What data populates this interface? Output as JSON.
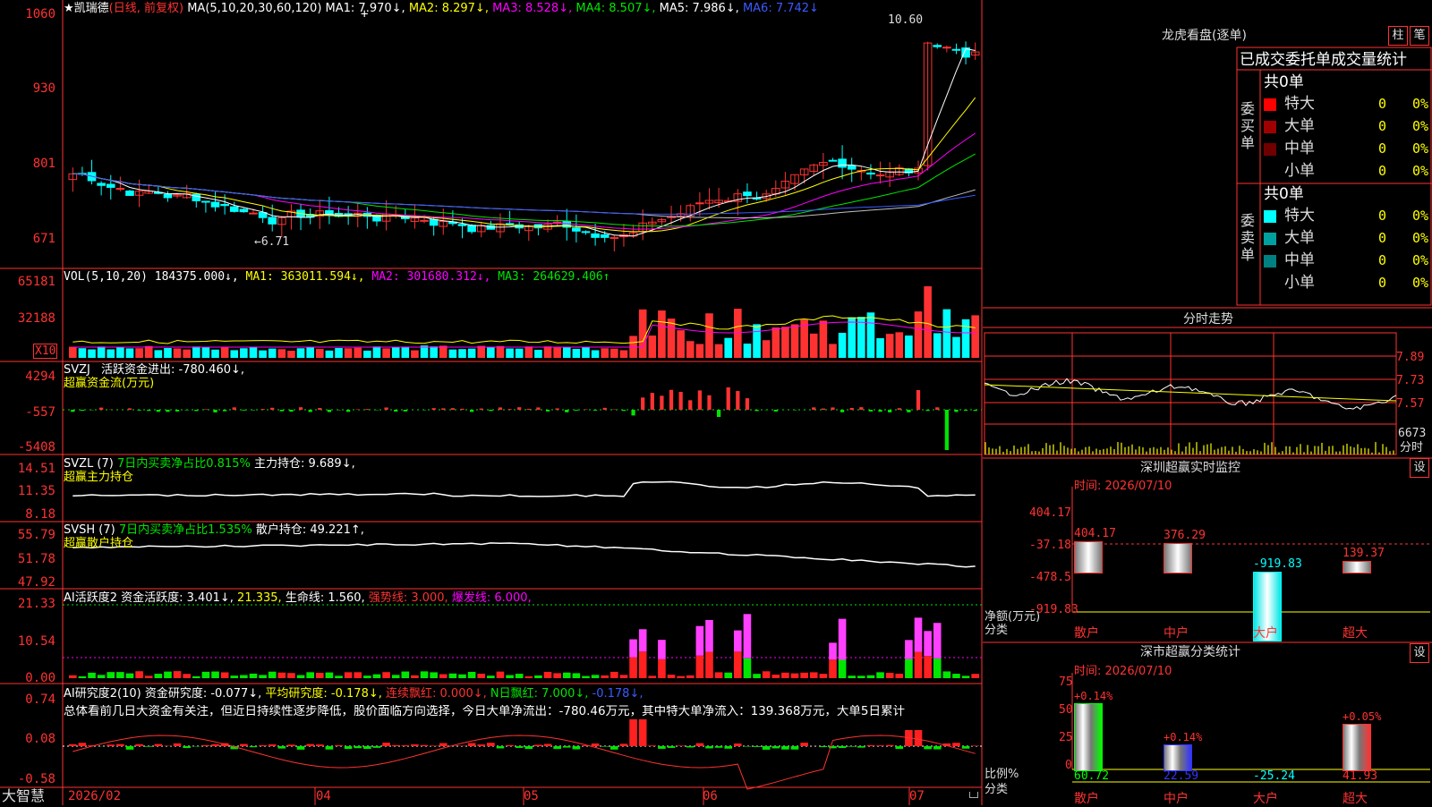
{
  "left_axis": {
    "kline": [
      "1060",
      "930",
      "801",
      "671"
    ],
    "vol": [
      "65181",
      "32188",
      "X10"
    ],
    "svzj": [
      "4294",
      "-557",
      "-5408"
    ],
    "svzl": [
      "14.51",
      "11.35",
      "8.18"
    ],
    "svsh": [
      "55.79",
      "51.78",
      "47.92"
    ],
    "ai2": [
      "21.33",
      "10.54",
      "0.00"
    ],
    "ai3": [
      "0.74",
      "0.08",
      "-0.58"
    ]
  },
  "kline": {
    "stock": "★凯瑞德",
    "mode": "(日线, 前复权)",
    "ma_label": "MA(5,10,20,30,60,120)",
    "ma1": "MA1: 7.970↓,",
    "ma2": "MA2: 8.297↓,",
    "ma3": "MA3: 8.528↓,",
    "ma4": "MA4: 8.507↓,",
    "ma5": "MA5: 7.986↓,",
    "ma6": "MA6: 7.742↓",
    "high_mark": "10.60",
    "low_mark": "←6.71",
    "colors": {
      "up": "#ff3232",
      "down": "#00ffff",
      "ma1": "#ffffff",
      "ma2": "#ffff00",
      "ma3": "#ff00ff",
      "ma4": "#00e600",
      "ma5": "#c0c0c0",
      "ma6": "#3a5bff"
    }
  },
  "vol": {
    "label": "VOL(5,10,20)",
    "value": "184375.000↓,",
    "ma1": "MA1: 363011.594↓,",
    "ma2": "MA2: 301680.312↓,",
    "ma3": "MA3: 264629.406↑"
  },
  "svzj": {
    "label": "SVZJ",
    "text": "活跃资金进出: -780.460↓,",
    "sub": "超赢资金流(万元)"
  },
  "svzl": {
    "label": "SVZL (7)",
    "text": "7日内买卖净占比0.815%",
    "text2": "主力持仓: 9.689↓,",
    "sub": "超赢主力持仓"
  },
  "svsh": {
    "label": "SVSH (7)",
    "text": "7日内买卖净占比1.535%",
    "text2": "散户持仓: 49.221↑,",
    "sub": "超赢散户持仓"
  },
  "ai2": {
    "label": "AI活跃度2",
    "t1": "资金活跃度: 3.401↓,",
    "t2": "21.335,",
    "t3": "生命线: 1.560,",
    "t4": "强势线: 3.000,",
    "t5": "爆发线: 6.000,"
  },
  "ai3": {
    "label": "AI研究度2(10)",
    "t1": "资金研究度: -0.077↓,",
    "t2": "平均研究度: -0.178↓,",
    "t3": "连续飘红: 0.000↓,",
    "t4": "N日飘红: 7.000↓,",
    "t5": "-0.178↓,",
    "summary": "总体看前几日大资金有关注，但近日持续性逐步降低，股价面临方向选择，今日大单净流出：-780.46万元，其中特大单净流入：139.368万元，大单5日累计"
  },
  "footer": {
    "brand": "大智慧",
    "dates": [
      "2026/02",
      "04",
      "05",
      "06",
      "07"
    ]
  },
  "dragon": {
    "title": "龙虎看盘(逐单)",
    "btn1": "柱",
    "btn2": "笔",
    "header": "已成交委托单成交量统计",
    "buy_label": "委买单",
    "sell_label": "委卖单",
    "buy_total": "共0单",
    "sell_total": "共0单",
    "buy_rows": [
      {
        "name": "特大",
        "count": "0",
        "pct": "0%",
        "color": "#ff0000"
      },
      {
        "name": "大单",
        "count": "0",
        "pct": "0%",
        "color": "#a00000"
      },
      {
        "name": "中单",
        "count": "0",
        "pct": "0%",
        "color": "#700000"
      },
      {
        "name": "小单",
        "count": "0",
        "pct": "0%",
        "color": ""
      }
    ],
    "sell_rows": [
      {
        "name": "特大",
        "count": "0",
        "pct": "0%",
        "color": "#00ffff"
      },
      {
        "name": "大单",
        "count": "0",
        "pct": "0%",
        "color": "#00a0a0"
      },
      {
        "name": "中单",
        "count": "0",
        "pct": "0%",
        "color": "#008080"
      },
      {
        "name": "小单",
        "count": "0",
        "pct": "0%",
        "color": ""
      }
    ]
  },
  "intraday": {
    "title": "分时走势",
    "axis": [
      "7.89",
      "7.73",
      "7.57",
      "6673"
    ],
    "axis_bottom": "分时"
  },
  "monitor": {
    "title": "深圳超赢实时监控",
    "btn": "设",
    "time": "时间: 2026/07/10",
    "axis": [
      "404.17",
      "-37.18",
      "-478.5",
      "-919.83"
    ],
    "y_label": "净额(万元)",
    "x_label": "分类",
    "bars": [
      {
        "name": "散户",
        "value": "404.17"
      },
      {
        "name": "中户",
        "value": "376.29"
      },
      {
        "name": "大户",
        "value": "-919.83"
      },
      {
        "name": "超大",
        "value": "139.37"
      }
    ]
  },
  "classify": {
    "title": "深市超赢分类统计",
    "btn": "设",
    "time": "时间: 2026/07/10",
    "axis": [
      "75",
      "50",
      "25",
      "0"
    ],
    "y_label": "比例%",
    "x_label": "分类",
    "bars": [
      {
        "name": "散户",
        "top": "+0.14%",
        "bottom": "60.72",
        "color": "#00ff00"
      },
      {
        "name": "中户",
        "top": "+0.14%",
        "bottom": "22.59",
        "color": "#3333ff"
      },
      {
        "name": "大户",
        "top": "",
        "bottom": "-25.24",
        "color": "#00ffff"
      },
      {
        "name": "超大",
        "top": "+0.05%",
        "bottom": "41.93",
        "color": "#ff3232"
      }
    ]
  }
}
